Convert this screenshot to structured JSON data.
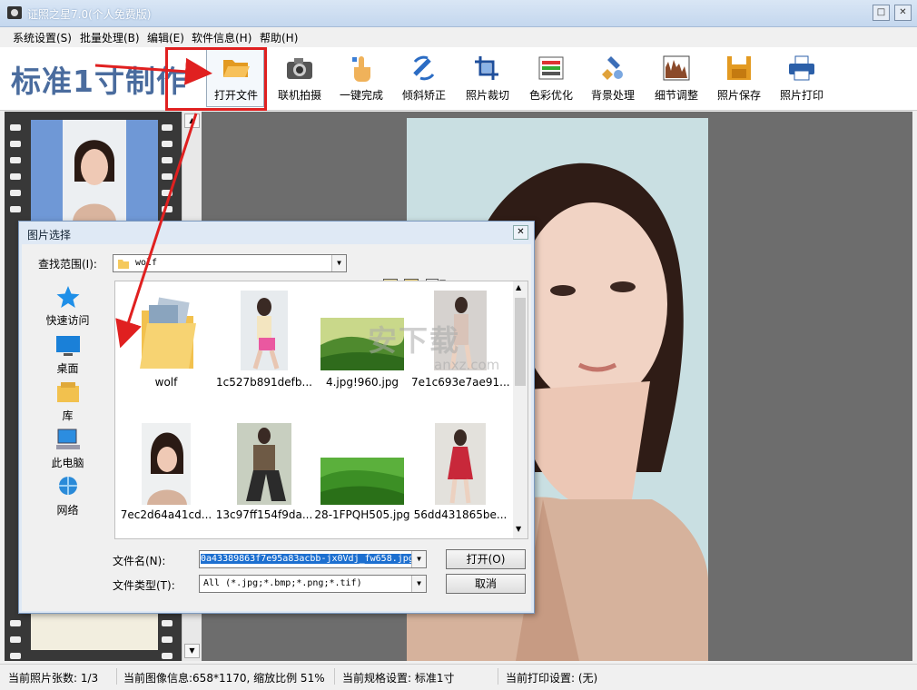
{
  "window": {
    "title": "证照之星7.0(个人免费版)",
    "minimize": "□",
    "close": "✕"
  },
  "menu": [
    "系统设置(S)",
    "批量处理(B)",
    "编辑(E)",
    "软件信息(H)",
    "帮助(H)"
  ],
  "toolbar": {
    "logo": "标准1寸制作",
    "buttons": [
      {
        "label": "打开文件",
        "icon": "folder-open-icon"
      },
      {
        "label": "联机拍摄",
        "icon": "camera-icon"
      },
      {
        "label": "一键完成",
        "icon": "hand-click-icon"
      },
      {
        "label": "倾斜矫正",
        "icon": "rotate-icon"
      },
      {
        "label": "照片裁切",
        "icon": "crop-icon"
      },
      {
        "label": "色彩优化",
        "icon": "color-bars-icon"
      },
      {
        "label": "背景处理",
        "icon": "brush-icon"
      },
      {
        "label": "细节调整",
        "icon": "histogram-icon"
      },
      {
        "label": "照片保存",
        "icon": "floppy-icon"
      },
      {
        "label": "照片打印",
        "icon": "printer-icon"
      }
    ]
  },
  "dialog": {
    "title": "图片选择",
    "close": "✕",
    "look_in_label": "查找范围(I):",
    "look_in_value": "wolf",
    "places": [
      "快速访问",
      "桌面",
      "库",
      "此电脑",
      "网络"
    ],
    "files": [
      {
        "name": "wolf",
        "type": "folder"
      },
      {
        "name": "1c527b891defb...",
        "type": "portrait"
      },
      {
        "name": "4.jpg!960.jpg",
        "type": "landscape"
      },
      {
        "name": "7e1c693e7ae91...",
        "type": "portrait"
      },
      {
        "name": "7ec2d64a41cd...",
        "type": "portrait"
      },
      {
        "name": "13c97ff154f9da...",
        "type": "portrait"
      },
      {
        "name": "28-1FPQH505.jpg",
        "type": "landscape"
      },
      {
        "name": "56dd431865be...",
        "type": "portrait"
      }
    ],
    "filename_label": "文件名(N):",
    "filename_value": "0a43389863f7e95a83acbb-jx0Vdj_fw658.jpg",
    "filetype_label": "文件类型(T):",
    "filetype_value": "All (*.jpg;*.bmp;*.png;*.tif)",
    "open_button": "打开(O)",
    "cancel_button": "取消"
  },
  "watermark": {
    "main": "安下载",
    "sub": "anxz.com"
  },
  "status": {
    "count": "当前照片张数: 1/3",
    "image_info": "当前图像信息:658*1170, 缩放比例 51%",
    "spec": "当前规格设置: 标准1寸",
    "print": "当前打印设置: (无)"
  },
  "colors": {
    "accent": "#4a6c9e",
    "highlight": "#e02020",
    "preview_bg": "#6d6d6d"
  }
}
